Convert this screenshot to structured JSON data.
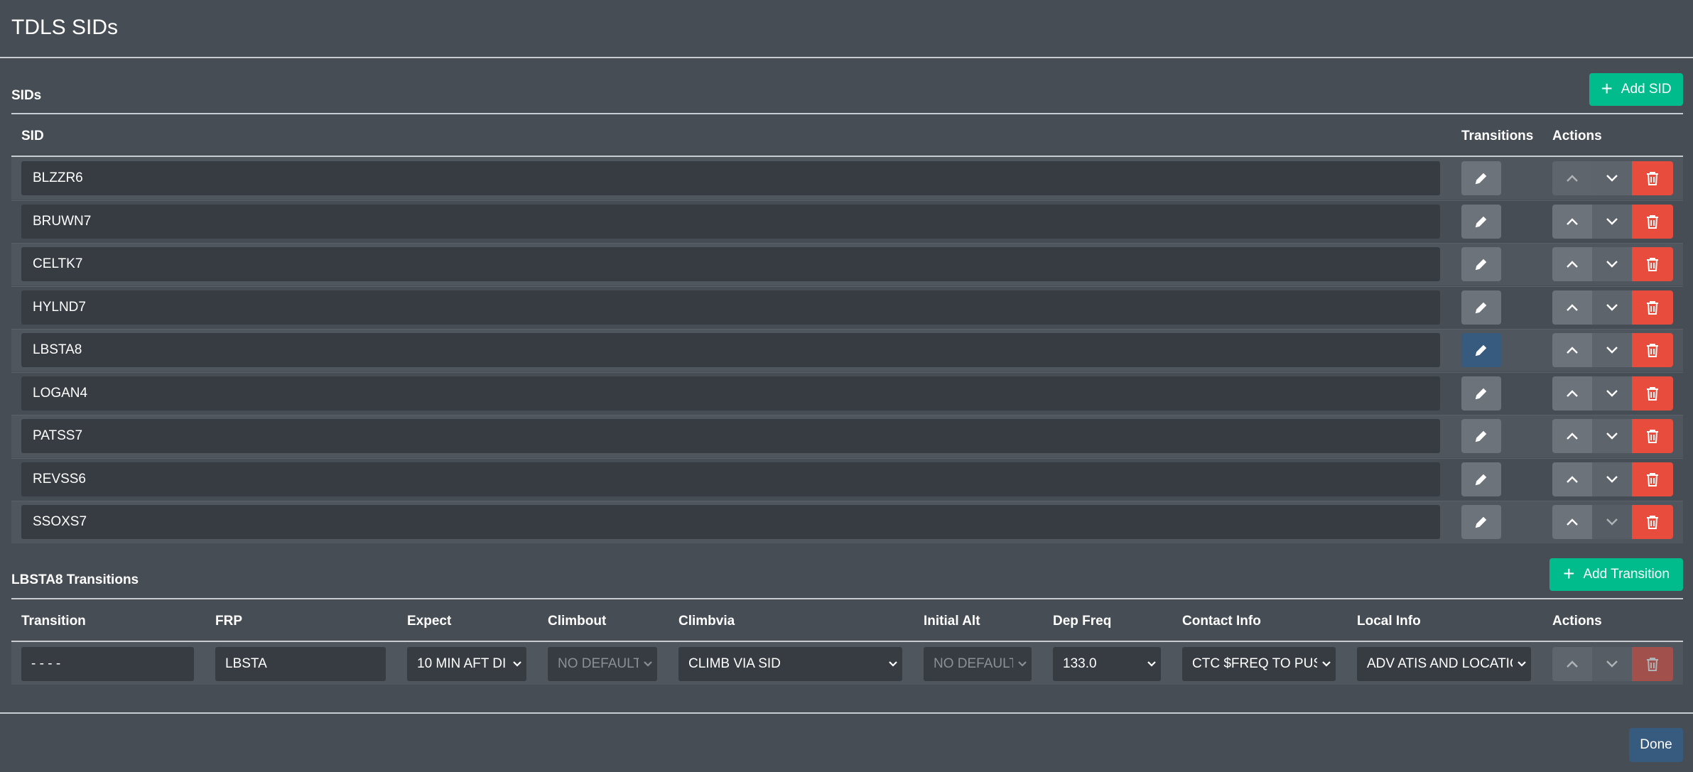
{
  "modal": {
    "title": "TDLS SIDs"
  },
  "sids_section": {
    "title": "SIDs",
    "add_label": "Add SID",
    "headers": {
      "sid": "SID",
      "transitions": "Transitions",
      "actions": "Actions"
    },
    "rows": [
      {
        "name": "BLZZR6",
        "selected": false,
        "up_disabled": true,
        "down_disabled": false
      },
      {
        "name": "BRUWN7",
        "selected": false,
        "up_disabled": false,
        "down_disabled": false
      },
      {
        "name": "CELTK7",
        "selected": false,
        "up_disabled": false,
        "down_disabled": false
      },
      {
        "name": "HYLND7",
        "selected": false,
        "up_disabled": false,
        "down_disabled": false
      },
      {
        "name": "LBSTA8",
        "selected": true,
        "up_disabled": false,
        "down_disabled": false
      },
      {
        "name": "LOGAN4",
        "selected": false,
        "up_disabled": false,
        "down_disabled": false
      },
      {
        "name": "PATSS7",
        "selected": false,
        "up_disabled": false,
        "down_disabled": false
      },
      {
        "name": "REVSS6",
        "selected": false,
        "up_disabled": false,
        "down_disabled": false
      },
      {
        "name": "SSOXS7",
        "selected": false,
        "up_disabled": false,
        "down_disabled": true
      }
    ]
  },
  "transitions_section": {
    "title": "LBSTA8 Transitions",
    "add_label": "Add Transition",
    "headers": {
      "transition": "Transition",
      "frp": "FRP",
      "expect": "Expect",
      "climbout": "Climbout",
      "climbvia": "Climbvia",
      "initial_alt": "Initial Alt",
      "dep_freq": "Dep Freq",
      "contact_info": "Contact Info",
      "local_info": "Local Info",
      "actions": "Actions"
    },
    "row": {
      "transition": "- - - -",
      "frp": "LBSTA",
      "expect": "10 MIN AFT DI",
      "climbout": "NO DEFAULT",
      "climbvia": "CLIMB VIA SID",
      "initial_alt": "NO DEFAULT",
      "dep_freq": "133.0",
      "contact_info": "CTC $FREQ TO PUSH",
      "local_info": "ADV ATIS AND LOCATIO"
    }
  },
  "footer": {
    "done_label": "Done"
  },
  "colors": {
    "background": "#464d55",
    "success": "#00bc8c",
    "primary": "#375a7f",
    "danger": "#e74c3c",
    "secondary": "#6d737a",
    "input": "#373c43"
  }
}
